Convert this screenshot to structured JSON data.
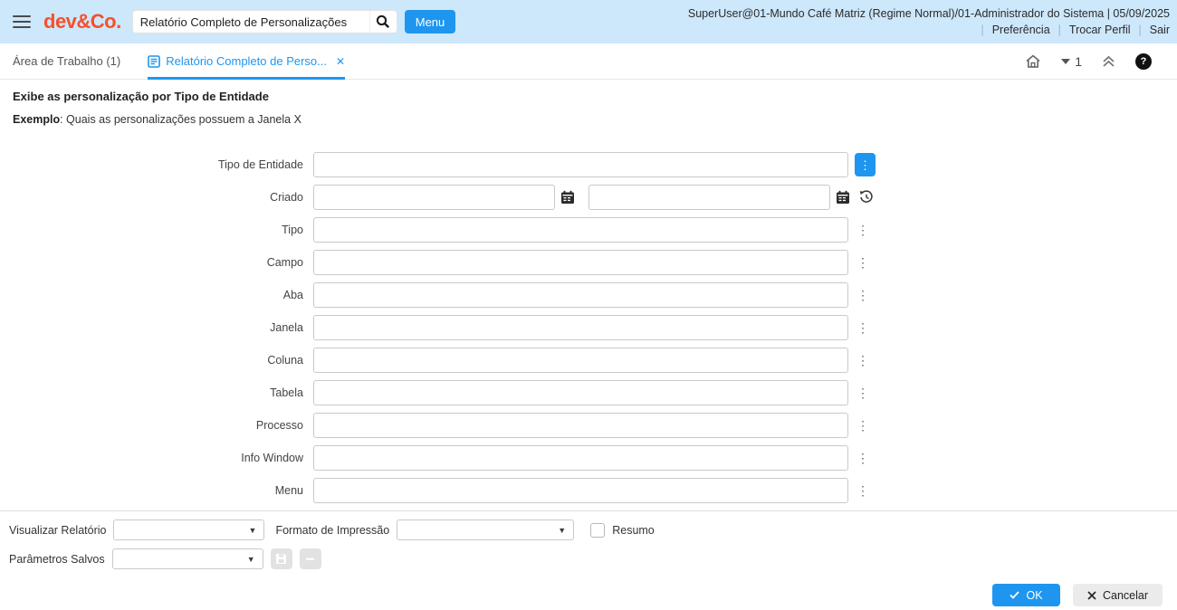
{
  "colors": {
    "header_bg": "#cde7fb",
    "accent_blue": "#1e96f0",
    "logo_orange": "#f4512c"
  },
  "header": {
    "logo_text": "dev&Co.",
    "search_value": "Relatório Completo de Personalizações",
    "menu_button_label": "Menu",
    "user_info": "SuperUser@01-Mundo Café Matriz (Regime Normal)/01-Administrador do Sistema | 05/09/2025",
    "nav_links": [
      {
        "label": "Preferência"
      },
      {
        "label": "Trocar Perfil"
      },
      {
        "label": "Sair"
      }
    ]
  },
  "tabbar": {
    "workspace_tab_label": "Área de Trabalho (1)",
    "active_tab_label": "Relatório Completo de Perso...",
    "desktop_number": "1"
  },
  "process": {
    "description": "Exibe as personalização por Tipo de Entidade",
    "example_prefix": "Exemplo",
    "example_text": ": Quais as personalizações possuem a Janela X"
  },
  "fields": [
    {
      "label": "Tipo de Entidade",
      "type": "lookup",
      "active": true
    },
    {
      "label": "Criado",
      "type": "daterange",
      "active": false
    },
    {
      "label": "Tipo",
      "type": "lookup",
      "active": false
    },
    {
      "label": "Campo",
      "type": "lookup",
      "active": false
    },
    {
      "label": "Aba",
      "type": "lookup",
      "active": false
    },
    {
      "label": "Janela",
      "type": "lookup",
      "active": false
    },
    {
      "label": "Coluna",
      "type": "lookup",
      "active": false
    },
    {
      "label": "Tabela",
      "type": "lookup",
      "active": false
    },
    {
      "label": "Processo",
      "type": "lookup",
      "active": false
    },
    {
      "label": "Info Window",
      "type": "lookup",
      "active": false
    },
    {
      "label": "Menu",
      "type": "lookup",
      "active": false
    }
  ],
  "report_controls": {
    "view_report_label": "Visualizar Relatório",
    "print_format_label": "Formato de Impressão",
    "summary_label": "Resumo",
    "saved_params_label": "Parâmetros Salvos"
  },
  "actions": {
    "ok_label": "OK",
    "cancel_label": "Cancelar"
  }
}
